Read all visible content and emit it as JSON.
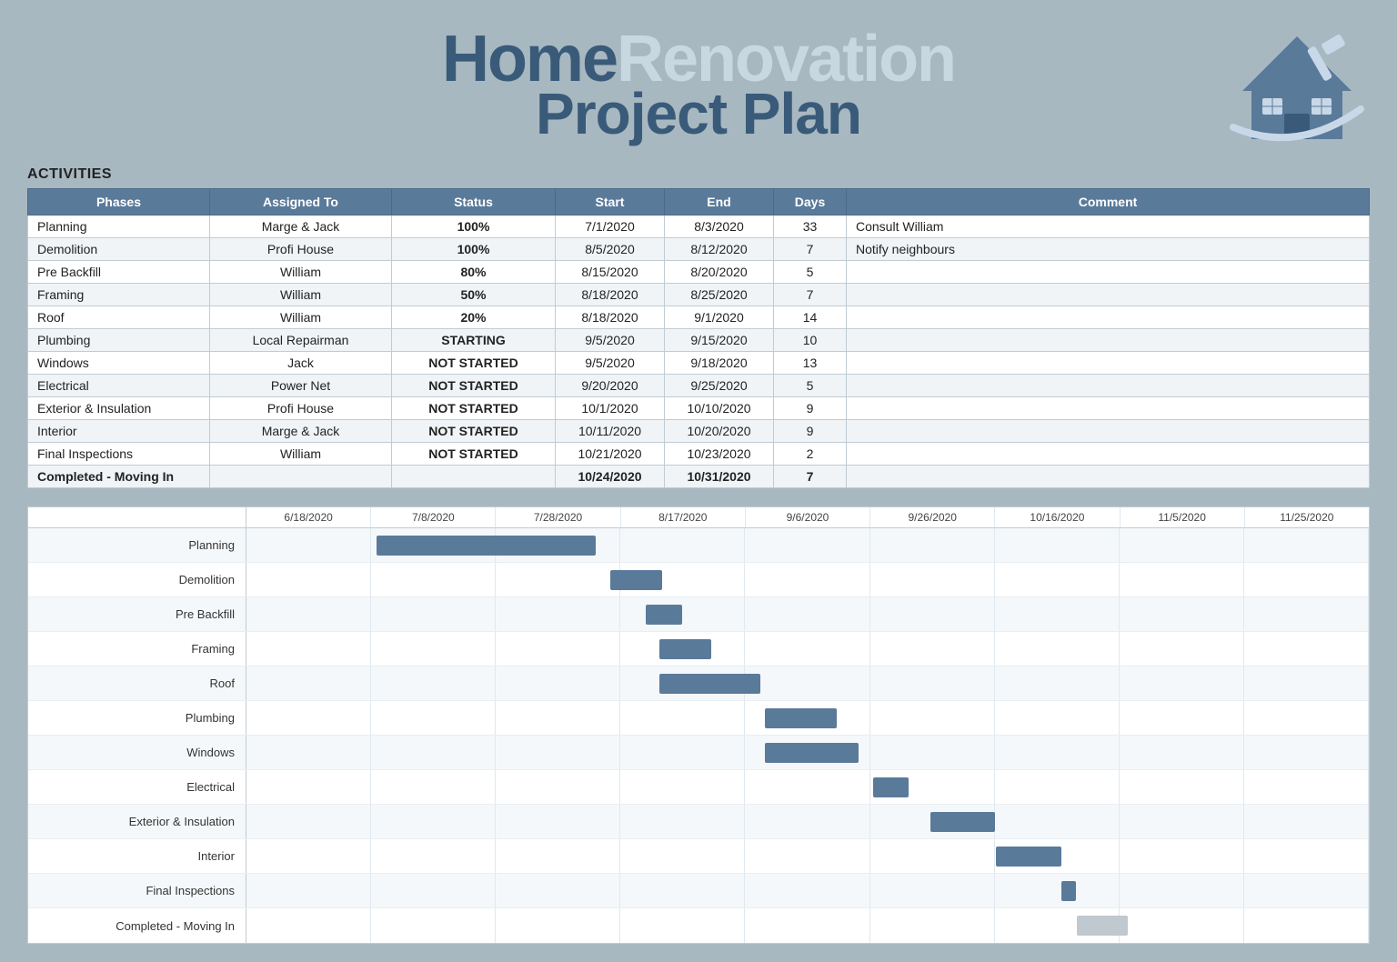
{
  "header": {
    "title_home": "Home",
    "title_renovation": "Renovation",
    "title_line2": "Project Plan"
  },
  "activities_label": "ACTIVITIES",
  "table": {
    "headers": [
      "Phases",
      "Assigned To",
      "Status",
      "Start",
      "End",
      "Days",
      "Comment"
    ],
    "rows": [
      {
        "phase": "Planning",
        "assigned": "Marge & Jack",
        "status": "100%",
        "status_class": "status-100",
        "start": "7/1/2020",
        "end": "8/3/2020",
        "days": "33",
        "comment": "Consult William"
      },
      {
        "phase": "Demolition",
        "assigned": "Profi House",
        "status": "100%",
        "status_class": "status-100",
        "start": "8/5/2020",
        "end": "8/12/2020",
        "days": "7",
        "comment": "Notify neighbours"
      },
      {
        "phase": "Pre Backfill",
        "assigned": "William",
        "status": "80%",
        "status_class": "status-80",
        "start": "8/15/2020",
        "end": "8/20/2020",
        "days": "5",
        "comment": ""
      },
      {
        "phase": "Framing",
        "assigned": "William",
        "status": "50%",
        "status_class": "status-50",
        "start": "8/18/2020",
        "end": "8/25/2020",
        "days": "7",
        "comment": ""
      },
      {
        "phase": "Roof",
        "assigned": "William",
        "status": "20%",
        "status_class": "status-20",
        "start": "8/18/2020",
        "end": "9/1/2020",
        "days": "14",
        "comment": ""
      },
      {
        "phase": "Plumbing",
        "assigned": "Local Repairman",
        "status": "STARTING",
        "status_class": "status-starting",
        "start": "9/5/2020",
        "end": "9/15/2020",
        "days": "10",
        "comment": ""
      },
      {
        "phase": "Windows",
        "assigned": "Jack",
        "status": "NOT STARTED",
        "status_class": "status-not-started",
        "start": "9/5/2020",
        "end": "9/18/2020",
        "days": "13",
        "comment": ""
      },
      {
        "phase": "Electrical",
        "assigned": "Power Net",
        "status": "NOT STARTED",
        "status_class": "status-not-started",
        "start": "9/20/2020",
        "end": "9/25/2020",
        "days": "5",
        "comment": ""
      },
      {
        "phase": "Exterior & Insulation",
        "assigned": "Profi House",
        "status": "NOT STARTED",
        "status_class": "status-not-started",
        "start": "10/1/2020",
        "end": "10/10/2020",
        "days": "9",
        "comment": ""
      },
      {
        "phase": "Interior",
        "assigned": "Marge & Jack",
        "status": "NOT STARTED",
        "status_class": "status-not-started",
        "start": "10/11/2020",
        "end": "10/20/2020",
        "days": "9",
        "comment": ""
      },
      {
        "phase": "Final Inspections",
        "assigned": "William",
        "status": "NOT STARTED",
        "status_class": "status-not-started",
        "start": "10/21/2020",
        "end": "10/23/2020",
        "days": "2",
        "comment": ""
      },
      {
        "phase": "Completed - Moving In",
        "assigned": "",
        "status": "",
        "status_class": "",
        "start": "10/24/2020",
        "end": "10/31/2020",
        "days": "7",
        "comment": "",
        "bold": true
      }
    ]
  },
  "gantt": {
    "dates": [
      "6/18/2020",
      "7/8/2020",
      "7/28/2020",
      "8/17/2020",
      "9/6/2020",
      "9/26/2020",
      "10/16/2020",
      "11/5/2020",
      "11/25/2020"
    ],
    "rows": [
      {
        "label": "Planning",
        "bar_start": 0.116,
        "bar_width": 0.195,
        "gray": false
      },
      {
        "label": "Demolition",
        "bar_start": 0.324,
        "bar_width": 0.046,
        "gray": false
      },
      {
        "label": "Pre Backfill",
        "bar_start": 0.356,
        "bar_width": 0.032,
        "gray": false
      },
      {
        "label": "Framing",
        "bar_start": 0.368,
        "bar_width": 0.046,
        "gray": false
      },
      {
        "label": "Roof",
        "bar_start": 0.368,
        "bar_width": 0.09,
        "gray": false
      },
      {
        "label": "Plumbing",
        "bar_start": 0.462,
        "bar_width": 0.064,
        "gray": false
      },
      {
        "label": "Windows",
        "bar_start": 0.462,
        "bar_width": 0.083,
        "gray": false
      },
      {
        "label": "Electrical",
        "bar_start": 0.558,
        "bar_width": 0.032,
        "gray": false
      },
      {
        "label": "Exterior & Insulation",
        "bar_start": 0.609,
        "bar_width": 0.058,
        "gray": false
      },
      {
        "label": "Interior",
        "bar_start": 0.668,
        "bar_width": 0.058,
        "gray": false
      },
      {
        "label": "Final Inspections",
        "bar_start": 0.726,
        "bar_width": 0.013,
        "gray": false
      },
      {
        "label": "Completed - Moving In",
        "bar_start": 0.74,
        "bar_width": 0.045,
        "gray": true
      }
    ]
  }
}
